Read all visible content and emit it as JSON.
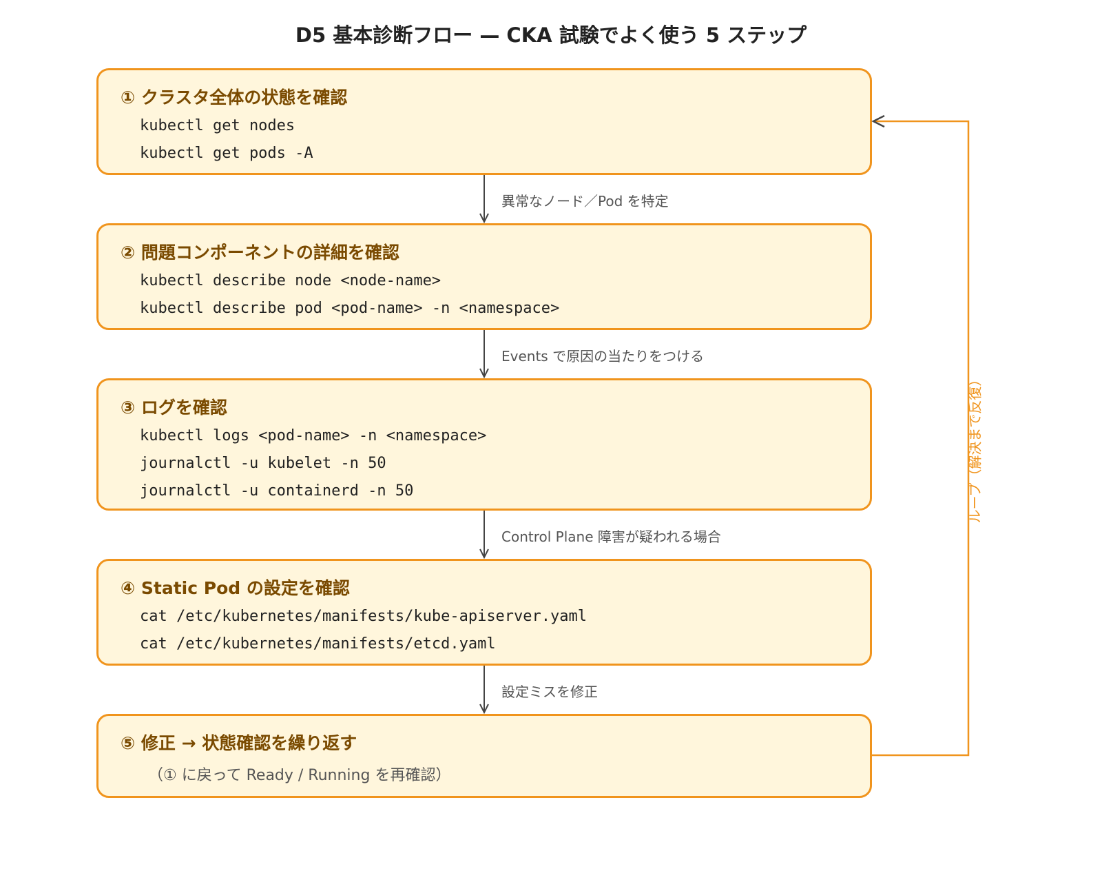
{
  "title": "D5 基本診断フロー — CKA 試験でよく使う 5 ステップ",
  "colors": {
    "accent": "#f0941d",
    "box_fill": "#fff6dc",
    "step_title": "#7a4a00",
    "arrow": "#444444"
  },
  "steps": [
    {
      "title": "① クラスタ全体の状態を確認",
      "commands": [
        "kubectl get nodes",
        "kubectl get pods -A"
      ]
    },
    {
      "title": "② 問題コンポーネントの詳細を確認",
      "commands": [
        "kubectl describe node <node-name>",
        "kubectl describe pod <pod-name> -n <namespace>"
      ]
    },
    {
      "title": "③ ログを確認",
      "commands": [
        "kubectl logs <pod-name> -n <namespace>",
        "journalctl -u kubelet -n 50",
        "journalctl -u containerd -n 50"
      ]
    },
    {
      "title": "④ Static Pod の設定を確認",
      "commands": [
        "cat /etc/kubernetes/manifests/kube-apiserver.yaml",
        "cat /etc/kubernetes/manifests/etcd.yaml"
      ]
    },
    {
      "title": "⑤ 修正 → 状態確認を繰り返す",
      "note": "（① に戻って Ready / Running を再確認）"
    }
  ],
  "transitions": [
    "異常なノード／Pod を特定",
    "Events で原因の当たりをつける",
    "Control Plane 障害が疑われる場合",
    "設定ミスを修正"
  ],
  "loop_label": "ループ（解決まで反復）"
}
